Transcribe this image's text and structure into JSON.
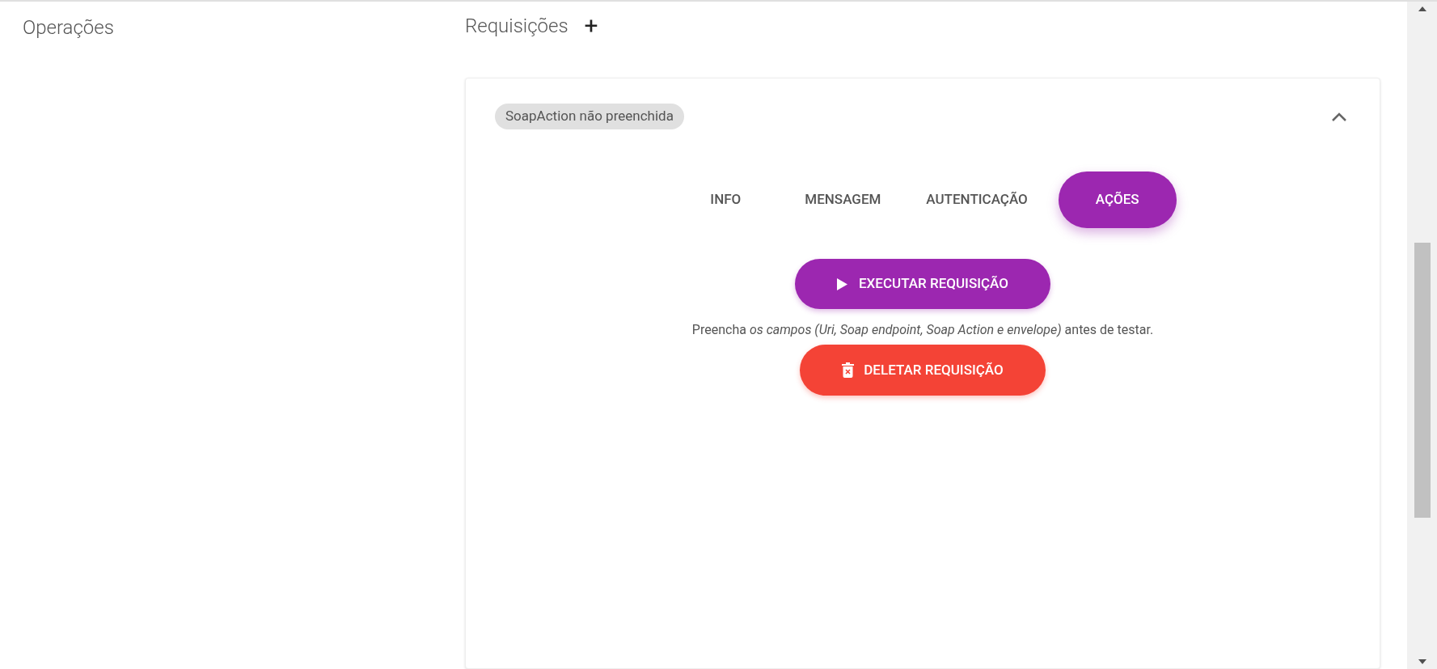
{
  "left_panel": {
    "title": "Operações"
  },
  "requests": {
    "title": "Requisições",
    "add_icon": "+",
    "card": {
      "chip": "SoapAction não preenchida",
      "expanded": true,
      "tabs": [
        {
          "label": "INFO",
          "selected": false
        },
        {
          "label": "MENSAGEM",
          "selected": false
        },
        {
          "label": "AUTENTICAÇÃO",
          "selected": false
        },
        {
          "label": "AÇÕES",
          "selected": true
        }
      ],
      "execute_button": "EXECUTAR REQUISIÇÃO",
      "hint": "Preencha *os campos (Uri, Soap endpoint, Soap Action e envelope)* antes de testar.",
      "delete_button": "DELETAR REQUISIÇÃO"
    }
  }
}
